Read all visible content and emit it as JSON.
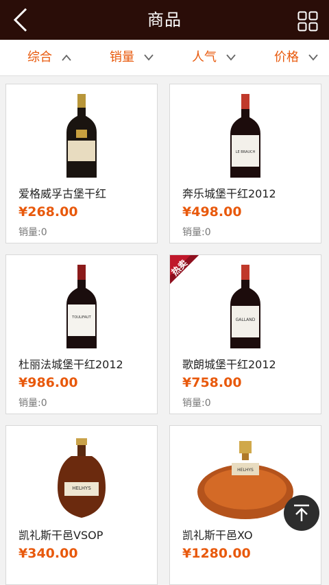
{
  "header": {
    "title": "商品"
  },
  "sort": [
    {
      "label": "综合"
    },
    {
      "label": "销量"
    },
    {
      "label": "人气"
    },
    {
      "label": "价格"
    }
  ],
  "products": [
    {
      "name": "爱格威孚古堡干红",
      "price": "¥268.00",
      "sales": "销量:0",
      "bottle_type": "red-wine-gold-label"
    },
    {
      "name": "奔乐城堡干红2012",
      "price": "¥498.00",
      "sales": "销量:0",
      "bottle_type": "red-wine-white-label",
      "label_text": "LE BRAUCH"
    },
    {
      "name": "杜丽法城堡干红2012",
      "price": "¥986.00",
      "sales": "销量:0",
      "bottle_type": "red-wine-white-label",
      "label_text": "TOULIFAUT"
    },
    {
      "name": "歌朗城堡干红2012",
      "price": "¥758.00",
      "sales": "销量:0",
      "bottle_type": "red-wine-white-label",
      "label_text": "GALLAND",
      "badge": "热卖"
    },
    {
      "name": "凯礼斯干邑VSOP",
      "price": "¥340.00",
      "sales": "",
      "bottle_type": "cognac-flask",
      "label_text": "HELHYS"
    },
    {
      "name": "凯礼斯干邑XO",
      "price": "¥1280.00",
      "sales": "",
      "bottle_type": "cognac-round",
      "label_text": "HELHYS"
    }
  ],
  "colors": {
    "header_bg": "#2a0d08",
    "accent": "#e8590c",
    "fab": "#2d2d2d"
  }
}
